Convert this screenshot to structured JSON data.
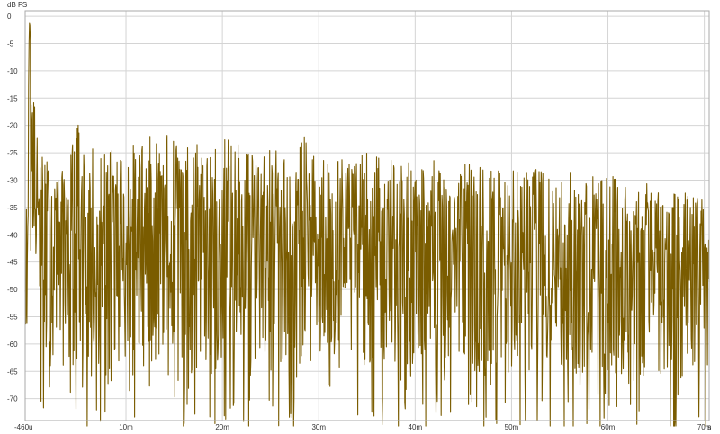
{
  "chart_data": {
    "type": "line",
    "title": "",
    "ylabel": "dB FS",
    "xlabel": "",
    "x_unit_label": "s",
    "xlim": [
      -0.00046,
      0.0705
    ],
    "ylim": [
      -74,
      1
    ],
    "grid": true,
    "colors": {
      "series": "#7a5c00",
      "grid": "#d4d4d4",
      "background": "#ffffff",
      "axis": "#aaaaaa"
    },
    "y_ticks": [
      {
        "value": 0,
        "label": "0"
      },
      {
        "value": -5,
        "label": "-5"
      },
      {
        "value": -10,
        "label": "-10"
      },
      {
        "value": -15,
        "label": "-15"
      },
      {
        "value": -20,
        "label": "-20"
      },
      {
        "value": -25,
        "label": "-25"
      },
      {
        "value": -30,
        "label": "-30"
      },
      {
        "value": -35,
        "label": "-35"
      },
      {
        "value": -40,
        "label": "-40"
      },
      {
        "value": -45,
        "label": "-45"
      },
      {
        "value": -50,
        "label": "-50"
      },
      {
        "value": -55,
        "label": "-55"
      },
      {
        "value": -60,
        "label": "-60"
      },
      {
        "value": -65,
        "label": "-65"
      },
      {
        "value": -70,
        "label": "-70"
      }
    ],
    "x_ticks": [
      {
        "value": -0.00046,
        "label": "-460u"
      },
      {
        "value": 0.01,
        "label": "10m"
      },
      {
        "value": 0.02,
        "label": "20m"
      },
      {
        "value": 0.03,
        "label": "30m"
      },
      {
        "value": 0.04,
        "label": "40m"
      },
      {
        "value": 0.05,
        "label": "50m"
      },
      {
        "value": 0.06,
        "label": "60m"
      },
      {
        "value": 0.07,
        "label": "70m"
      }
    ],
    "series": [
      {
        "description": "Impulse response magnitude envelope (peak near 0 dB at ~0 s, decaying noise floor)",
        "x": [
          -0.00046,
          -0.0003,
          -0.0002,
          -0.0001,
          0.0,
          0.0001,
          0.0002,
          0.0003,
          0.0004,
          0.0005,
          0.0006,
          0.0008,
          0.001,
          0.0012,
          0.0015,
          0.002,
          0.0025,
          0.003,
          0.004,
          0.005,
          0.006,
          0.008,
          0.01,
          0.012,
          0.015,
          0.018,
          0.02,
          0.025,
          0.028,
          0.03,
          0.035,
          0.04,
          0.045,
          0.05,
          0.055,
          0.06,
          0.065,
          0.07,
          0.0705
        ],
        "upper": [
          -40,
          -33,
          -20,
          -8,
          0,
          -6,
          -5,
          -9,
          -14,
          -13,
          -18,
          -22,
          -26,
          -26,
          -24,
          -27,
          -28,
          -29,
          -27,
          -18,
          -24,
          -24,
          -24,
          -22,
          -21,
          -22,
          -22,
          -24,
          -21,
          -25,
          -25,
          -26,
          -27,
          -28,
          -28,
          -29,
          -31,
          -33,
          -40
        ],
        "mid": [
          -48,
          -44,
          -35,
          -28,
          -18,
          -25,
          -24,
          -27,
          -30,
          -32,
          -33,
          -35,
          -37,
          -38,
          -38,
          -39,
          -39,
          -39,
          -39,
          -37,
          -39,
          -39,
          -39,
          -38,
          -38,
          -38,
          -38,
          -39,
          -38,
          -40,
          -41,
          -42,
          -43,
          -43,
          -44,
          -45,
          -45,
          -46,
          -49
        ],
        "lower": [
          -55,
          -60,
          -55,
          -50,
          -40,
          -45,
          -48,
          -50,
          -52,
          -55,
          -58,
          -60,
          -62,
          -64,
          -64,
          -64,
          -64,
          -65,
          -64,
          -64,
          -64,
          -64,
          -64,
          -64,
          -64,
          -64,
          -64,
          -64,
          -64,
          -64,
          -64,
          -65,
          -65,
          -65,
          -66,
          -66,
          -66,
          -66,
          -66
        ]
      }
    ]
  }
}
